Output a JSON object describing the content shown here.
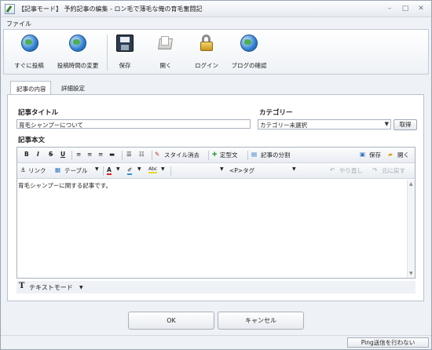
{
  "window": {
    "title": "【記事モード】 予約記事の編集 - ロン毛で薄毛な俺の育毛奮闘記",
    "min": "–",
    "max": "□",
    "close": "✕"
  },
  "menu": {
    "file": "ファイル"
  },
  "ribbon": {
    "post_now": "すぐに投稿",
    "change_time": "投稿時間の変更",
    "save": "保存",
    "open": "開く",
    "login": "ログイン",
    "blog_check": "ブログの確認"
  },
  "tabs": {
    "content": "記事の内容",
    "detail": "詳細設定"
  },
  "form": {
    "title_label": "記事タイトル",
    "title_value": "育毛シャンプーについて",
    "category_label": "カテゴリー",
    "category_value": "カテゴリー未選択",
    "fetch_button": "取得",
    "body_label": "記事本文",
    "body_text": "育毛シャンプーに関する記事です。"
  },
  "toolbar1": {
    "bold": "B",
    "italic": "I",
    "strike": "S",
    "underline": "U",
    "style_clear": "スタイル消去",
    "template": "定型文",
    "split": "記事の分割",
    "save": "保存",
    "open": "開く"
  },
  "toolbar2": {
    "link": "リンク",
    "table": "テーブル",
    "tag_select": "<P>タグ",
    "undo": "やり直し",
    "redo": "元に戻す"
  },
  "modebar": {
    "text_mode": "テキストモード"
  },
  "buttons": {
    "ok": "OK",
    "cancel": "キャンセル"
  },
  "status": {
    "ping": "Ping送信を行わない"
  }
}
